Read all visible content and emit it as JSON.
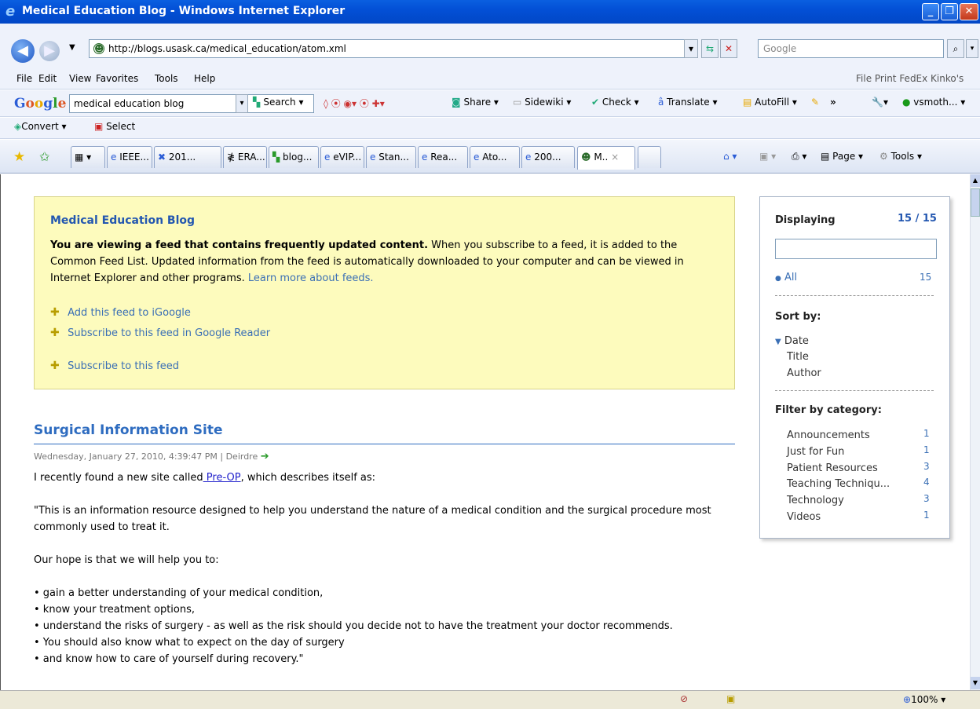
{
  "window": {
    "title": "Medical Education Blog - Windows Internet Explorer"
  },
  "address": {
    "url": "http://blogs.usask.ca/medical_education/atom.xml",
    "search_placeholder": "Google"
  },
  "menubar": {
    "items": [
      "File",
      "Edit",
      "View",
      "Favorites",
      "Tools",
      "Help"
    ],
    "right": "File Print FedEx Kinko's"
  },
  "google_toolbar": {
    "logo": "Google",
    "query": "medical education blog",
    "search": "Search",
    "share": "Share",
    "sidewiki": "Sidewiki",
    "check": "Check",
    "translate": "Translate",
    "autofill": "AutoFill",
    "more": "»",
    "user": "vsmoth..."
  },
  "convert_bar": {
    "convert": "Convert",
    "select": "Select"
  },
  "tabs": {
    "items": [
      "IEEE...",
      "201...",
      "ERA...",
      "blog...",
      "eVIP...",
      "Stan...",
      "Rea...",
      "Ato...",
      "200...",
      "M.."
    ],
    "close": "×",
    "page": "Page",
    "tools": "Tools"
  },
  "feed": {
    "title": "Medical Education Blog",
    "intro_bold": "You are viewing a feed that contains frequently updated content.",
    "intro_rest": " When you subscribe to a feed, it is added to the Common Feed List. Updated information from the feed is automatically downloaded to your computer and can be viewed in Internet Explorer and other programs. ",
    "learn_more": "Learn more about feeds.",
    "add_igoogle": "Add this feed to iGoogle",
    "google_reader": "Subscribe to this feed in Google Reader",
    "subscribe": "Subscribe to this feed"
  },
  "post": {
    "title": "Surgical Information Site",
    "meta": "Wednesday, January 27, 2010, 4:39:47 PM | Deirdre",
    "p1_before": "I recently found a new site called",
    "p1_link": " Pre-OP",
    "p1_after": ", which describes itself as:",
    "p2": "\"This is an information resource designed to help you understand the nature of a medical condition and the surgical procedure most commonly used to treat it.",
    "p3": "Our hope is that we will help you to:",
    "bullets": [
      "• gain a better understanding of your medical condition,",
      "• know your treatment options,",
      "• understand the risks of surgery - as well as the risk should you decide not to have the treatment your doctor recommends.",
      "• You should also know what to expect on the day of surgery",
      "• and know how to care of yourself during recovery.\""
    ]
  },
  "sidebar": {
    "displaying": "Displaying",
    "count": "15 / 15",
    "all_label": "All",
    "all_count": "15",
    "sort_by": "Sort by:",
    "sort_date": "Date",
    "sort_title": "Title",
    "sort_author": "Author",
    "filter_by": "Filter by category:",
    "categories": [
      {
        "name": "Announcements",
        "count": "1"
      },
      {
        "name": "Just for Fun",
        "count": "1"
      },
      {
        "name": "Patient Resources",
        "count": "3"
      },
      {
        "name": "Teaching Techniqu...",
        "count": "4"
      },
      {
        "name": "Technology",
        "count": "3"
      },
      {
        "name": "Videos",
        "count": "1"
      }
    ]
  },
  "status": {
    "zoom": "100%"
  }
}
